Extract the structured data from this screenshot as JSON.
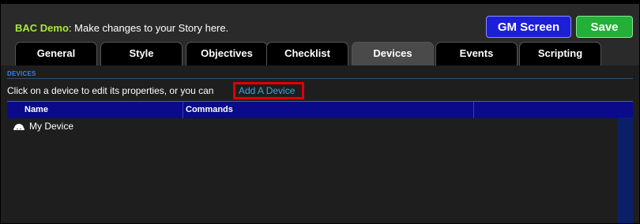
{
  "header": {
    "app_name": "BAC Demo",
    "subtitle": ": Make changes to your Story here.",
    "gm_screen_label": "GM Screen",
    "save_label": "Save"
  },
  "tabs": [
    {
      "label": "General",
      "active": false
    },
    {
      "label": "Style",
      "active": false
    },
    {
      "label": "Objectives",
      "active": false
    },
    {
      "label": "Checklist",
      "active": false
    },
    {
      "label": "Devices",
      "active": true
    },
    {
      "label": "Events",
      "active": false
    },
    {
      "label": "Scripting",
      "active": false
    }
  ],
  "devices": {
    "section_label": "DEVICES",
    "instructions": "Click on a device to edit its properties, or you can",
    "add_link": "Add A Device",
    "columns": [
      "Name",
      "Commands"
    ],
    "rows": [
      {
        "name": "My Device",
        "icon": "device-dome-icon"
      }
    ]
  },
  "colors": {
    "accent_green": "#a7ea3d",
    "gm_button": "#1c1fd6",
    "save_button": "#22b036",
    "table_header": "#0a0a8a",
    "link": "#2aaedf",
    "highlight": "#e00000"
  }
}
